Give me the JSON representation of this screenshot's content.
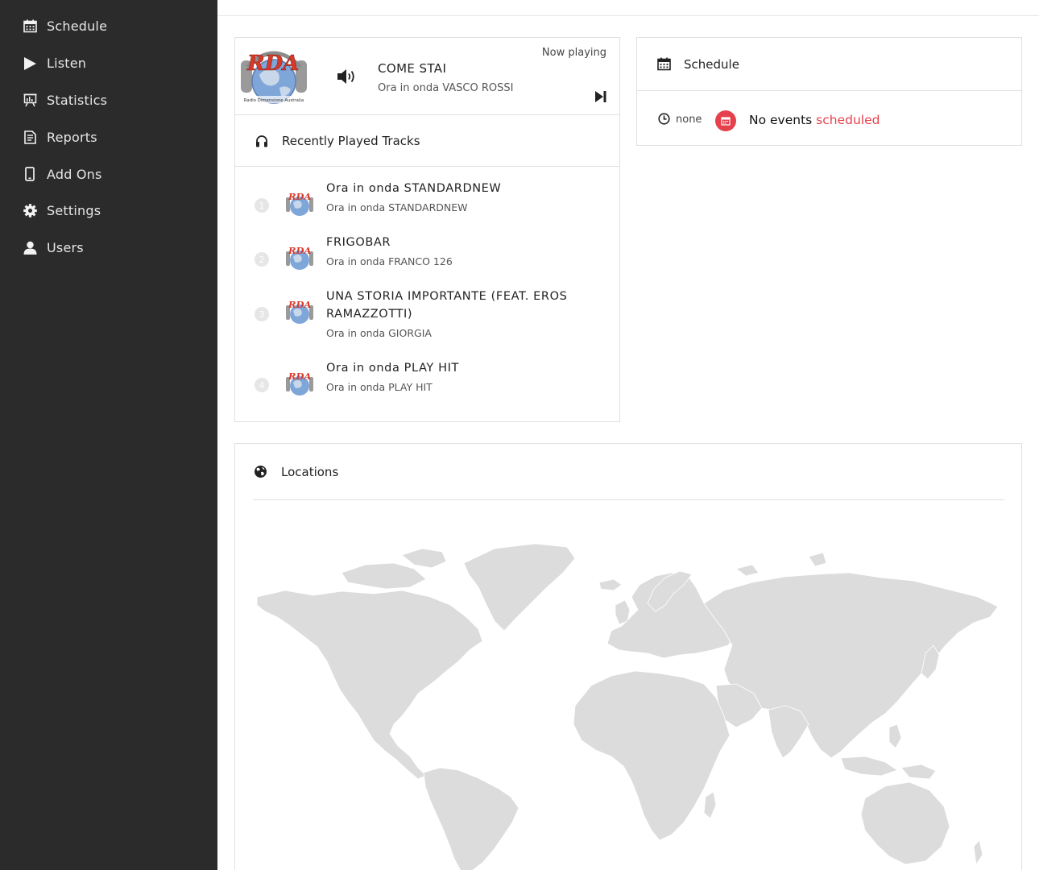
{
  "sidebar": {
    "items": [
      {
        "label": "Schedule",
        "icon": "calendar-icon"
      },
      {
        "label": "Listen",
        "icon": "play-icon"
      },
      {
        "label": "Statistics",
        "icon": "presentation-chart-icon"
      },
      {
        "label": "Reports",
        "icon": "document-icon"
      },
      {
        "label": "Add Ons",
        "icon": "mobile-phone-icon"
      },
      {
        "label": "Settings",
        "icon": "gear-icon"
      },
      {
        "label": "Users",
        "icon": "user-icon"
      }
    ]
  },
  "player": {
    "status": "Now playing",
    "title": "COME STAI",
    "subtitle": "Ora in onda VASCO ROSSI",
    "logo": {
      "letters": "RDA",
      "caption": "Radio Dimensione Australia"
    }
  },
  "recent": {
    "title": "Recently Played Tracks",
    "tracks": [
      {
        "num": "1",
        "title": "Ora in onda STANDARDNEW",
        "subtitle": "Ora in onda STANDARDNEW"
      },
      {
        "num": "2",
        "title": "FRIGOBAR",
        "subtitle": "Ora in onda FRANCO 126"
      },
      {
        "num": "3",
        "title": "UNA STORIA IMPORTANTE (FEAT. EROS RAMAZZOTTI)",
        "subtitle": "Ora in onda GIORGIA"
      },
      {
        "num": "4",
        "title": "Ora in onda PLAY HIT",
        "subtitle": "Ora in onda PLAY HIT"
      }
    ]
  },
  "schedule": {
    "title": "Schedule",
    "time": "none",
    "message_start": "No events ",
    "message_accent": "scheduled"
  },
  "locations": {
    "title": "Locations"
  },
  "colors": {
    "sidebar_bg": "#2b2b2b",
    "accent": "#e5414c",
    "map_land": "#dcdcdc",
    "border": "#e0e0e0"
  }
}
